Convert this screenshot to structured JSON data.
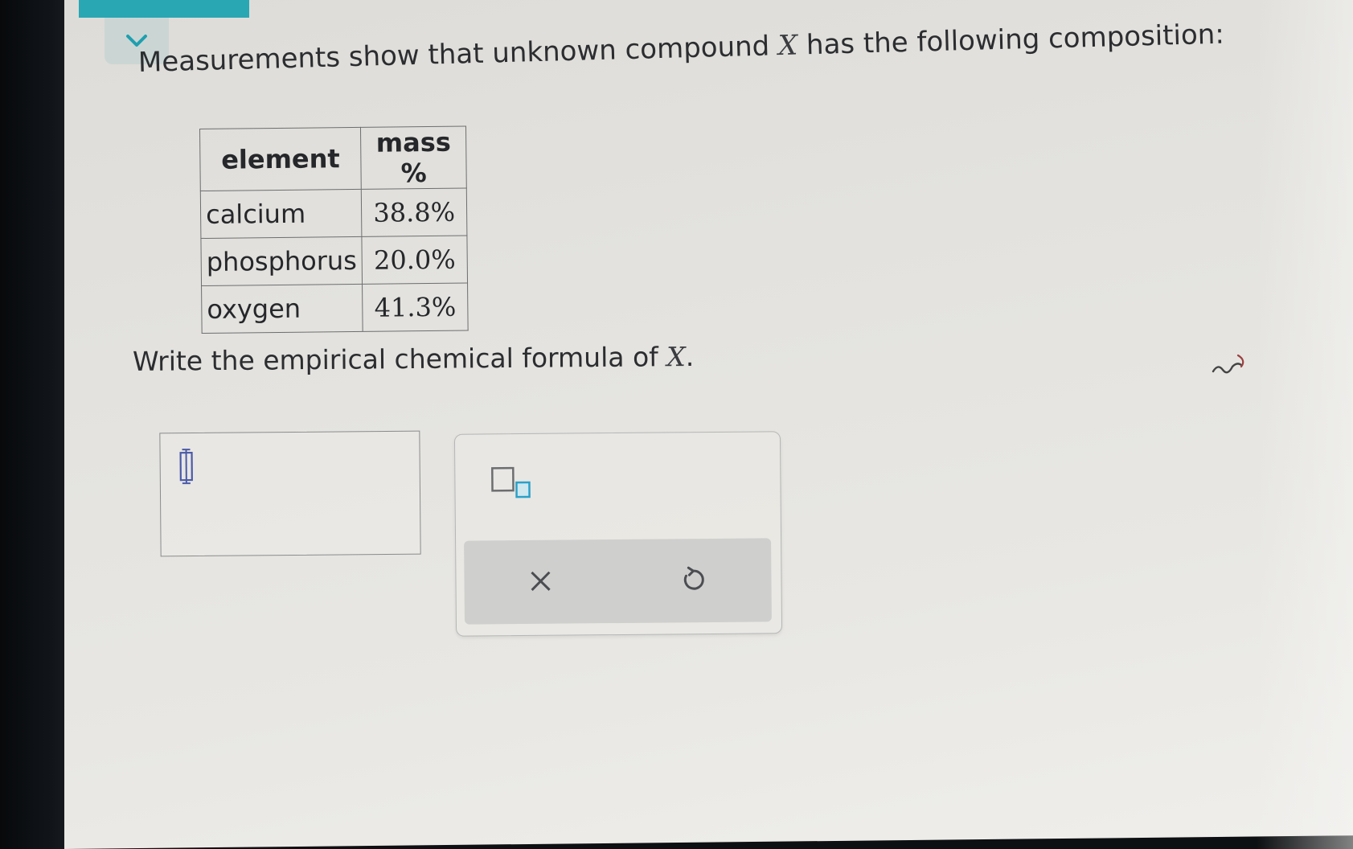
{
  "prompt": {
    "before": "Measurements show that unknown compound ",
    "variable": "X",
    "after": " has the following composition:"
  },
  "table": {
    "headers": [
      "element",
      "mass %"
    ],
    "rows": [
      {
        "element": "calcium",
        "mass": "38.8%"
      },
      {
        "element": "phosphorus",
        "mass": "20.0%"
      },
      {
        "element": "oxygen",
        "mass": "41.3%"
      }
    ]
  },
  "question": {
    "before": "Write the empirical chemical formula of ",
    "variable": "X",
    "after": "."
  },
  "answer": {
    "value": ""
  },
  "icons": {
    "collapse": "chevron-down-icon",
    "cursor": "text-cursor-icon",
    "subscript": "subscript-template-icon",
    "clear": "close-icon",
    "undo": "undo-icon",
    "pen": "squiggle-cursor-icon"
  },
  "colors": {
    "accent": "#29a7b3",
    "chevron": "#1f9fb0",
    "subscript_box": "#2aa0c8",
    "text": "#2b2d30"
  }
}
